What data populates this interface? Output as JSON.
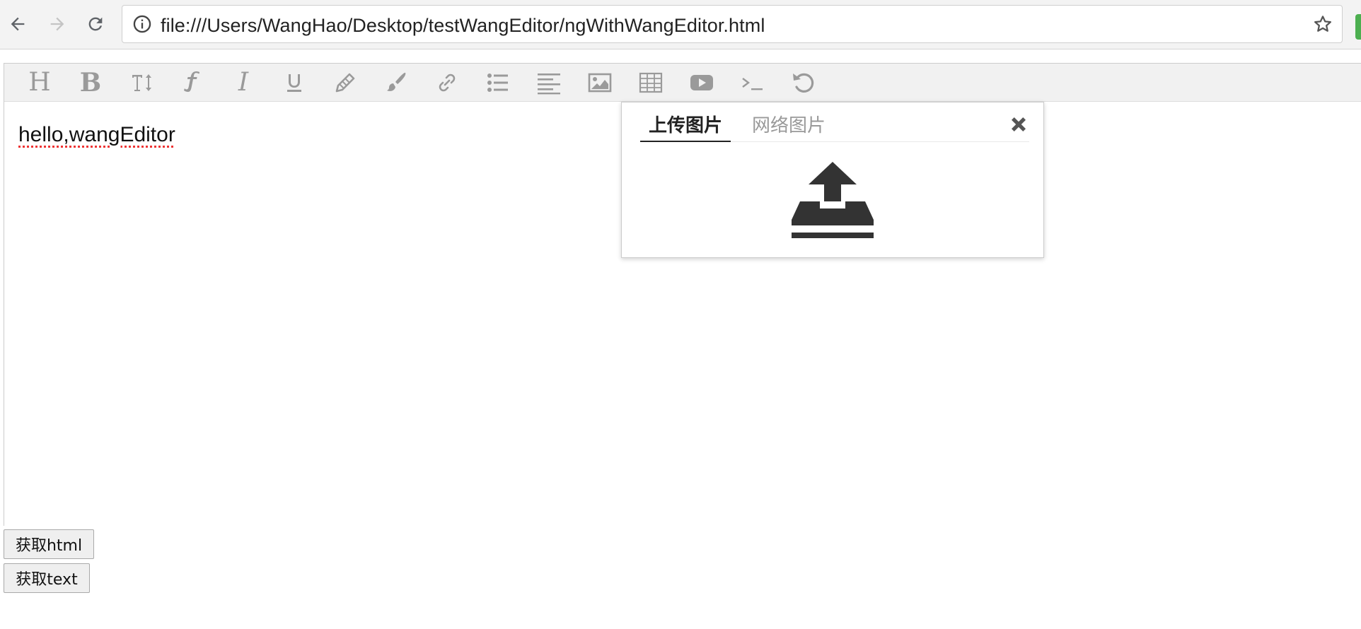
{
  "browser": {
    "url": "file:///Users/WangHao/Desktop/testWangEditor/ngWithWangEditor.html"
  },
  "toolbar": {
    "items": [
      {
        "name": "heading",
        "icon": "heading-icon",
        "glyph": "H"
      },
      {
        "name": "bold",
        "icon": "bold-icon",
        "glyph": "B"
      },
      {
        "name": "font-size",
        "icon": "font-size-icon"
      },
      {
        "name": "font-family",
        "icon": "font-family-icon"
      },
      {
        "name": "italic",
        "icon": "italic-icon",
        "glyph": "I"
      },
      {
        "name": "underline",
        "icon": "underline-icon"
      },
      {
        "name": "fore-color",
        "icon": "pencil-icon"
      },
      {
        "name": "back-color",
        "icon": "paintbrush-icon"
      },
      {
        "name": "link",
        "icon": "link-icon"
      },
      {
        "name": "list",
        "icon": "list-icon"
      },
      {
        "name": "justify",
        "icon": "align-left-icon"
      },
      {
        "name": "image",
        "icon": "image-icon"
      },
      {
        "name": "table",
        "icon": "table-icon"
      },
      {
        "name": "video",
        "icon": "video-icon"
      },
      {
        "name": "code",
        "icon": "terminal-icon"
      },
      {
        "name": "undo",
        "icon": "undo-icon"
      }
    ]
  },
  "editor": {
    "content": "hello,wangEditor"
  },
  "image_panel": {
    "tab_upload": "上传图片",
    "tab_network": "网络图片",
    "active_tab": "上传图片"
  },
  "buttons": {
    "get_html": "获取html",
    "get_text": "获取text"
  },
  "colors": {
    "toolbar_bg": "#f1f1f1",
    "icon_gray": "#9a9a9a",
    "upload_icon": "#333333",
    "spell_underline": "#e33333"
  }
}
